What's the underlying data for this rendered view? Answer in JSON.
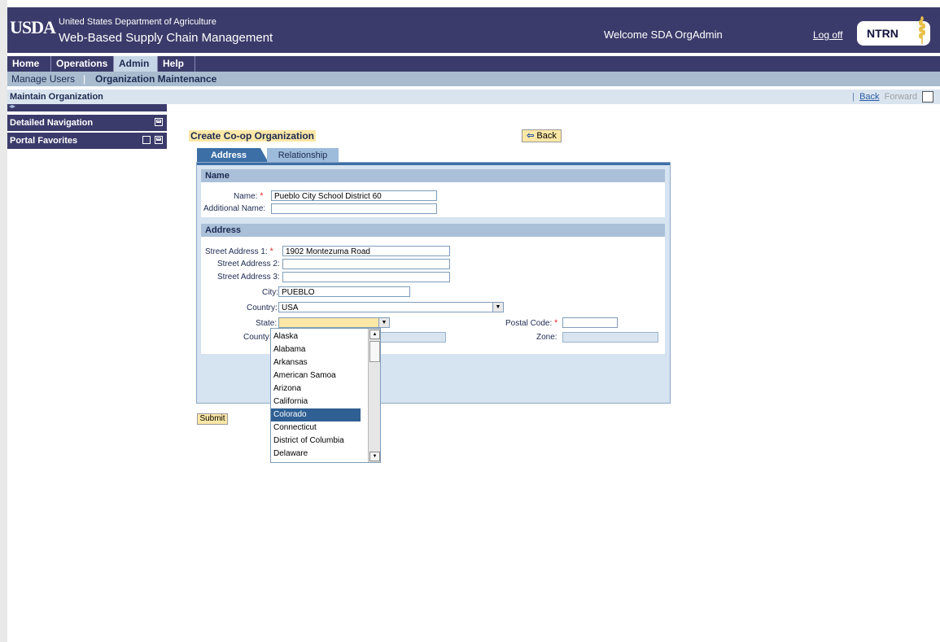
{
  "header": {
    "logo": "USDA",
    "department": "United States Department of Agriculture",
    "app_name": "Web-Based Supply Chain Management",
    "welcome": "Welcome SDA OrgAdmin",
    "logoff": "Log off",
    "badge": "NTRN"
  },
  "topnav": {
    "tabs": [
      "Home",
      "Operations",
      "Admin",
      "Help"
    ],
    "active": "Admin"
  },
  "subnav": {
    "items": [
      "Manage Users",
      "Organization Maintenance"
    ]
  },
  "pagebar": {
    "title": "Maintain Organization",
    "sep": "|",
    "back": "Back",
    "forward": "Forward"
  },
  "leftpanel": {
    "items": [
      "Detailed Navigation",
      "Portal Favorites"
    ]
  },
  "page": {
    "title": "Create Co-op Organization",
    "back_button": "Back"
  },
  "tabs": {
    "address": "Address",
    "relationship": "Relationship"
  },
  "name_section": {
    "heading": "Name",
    "name_label": "Name:",
    "name_value": "Pueblo City School District 60",
    "additional_label": "Additional Name:",
    "additional_value": ""
  },
  "address_section": {
    "heading": "Address",
    "street1_label": "Street Address 1:",
    "street1_value": "1902 Montezuma Road",
    "street2_label": "Street Address 2:",
    "street2_value": "",
    "street3_label": "Street Address 3:",
    "street3_value": "",
    "city_label": "City:",
    "city_value": "PUEBLO",
    "country_label": "Country:",
    "country_value": "USA",
    "state_label": "State:",
    "state_value": "",
    "postal_label": "Postal Code:",
    "postal_value": "",
    "county_label": "County:",
    "zone_label": "Zone:"
  },
  "required_marker": "*",
  "submit": "Submit",
  "state_options": [
    "Alaska",
    "Alabama",
    "Arkansas",
    "American Samoa",
    "Arizona",
    "California",
    "Colorado",
    "Connecticut",
    "District of Columbia",
    "Delaware"
  ],
  "state_highlighted": "Colorado",
  "colors": {
    "header_bg": "#3b3b6b",
    "accent_blue": "#3c6fa6",
    "button_yellow": "#fbe7a6",
    "required_red": "#e03030"
  }
}
